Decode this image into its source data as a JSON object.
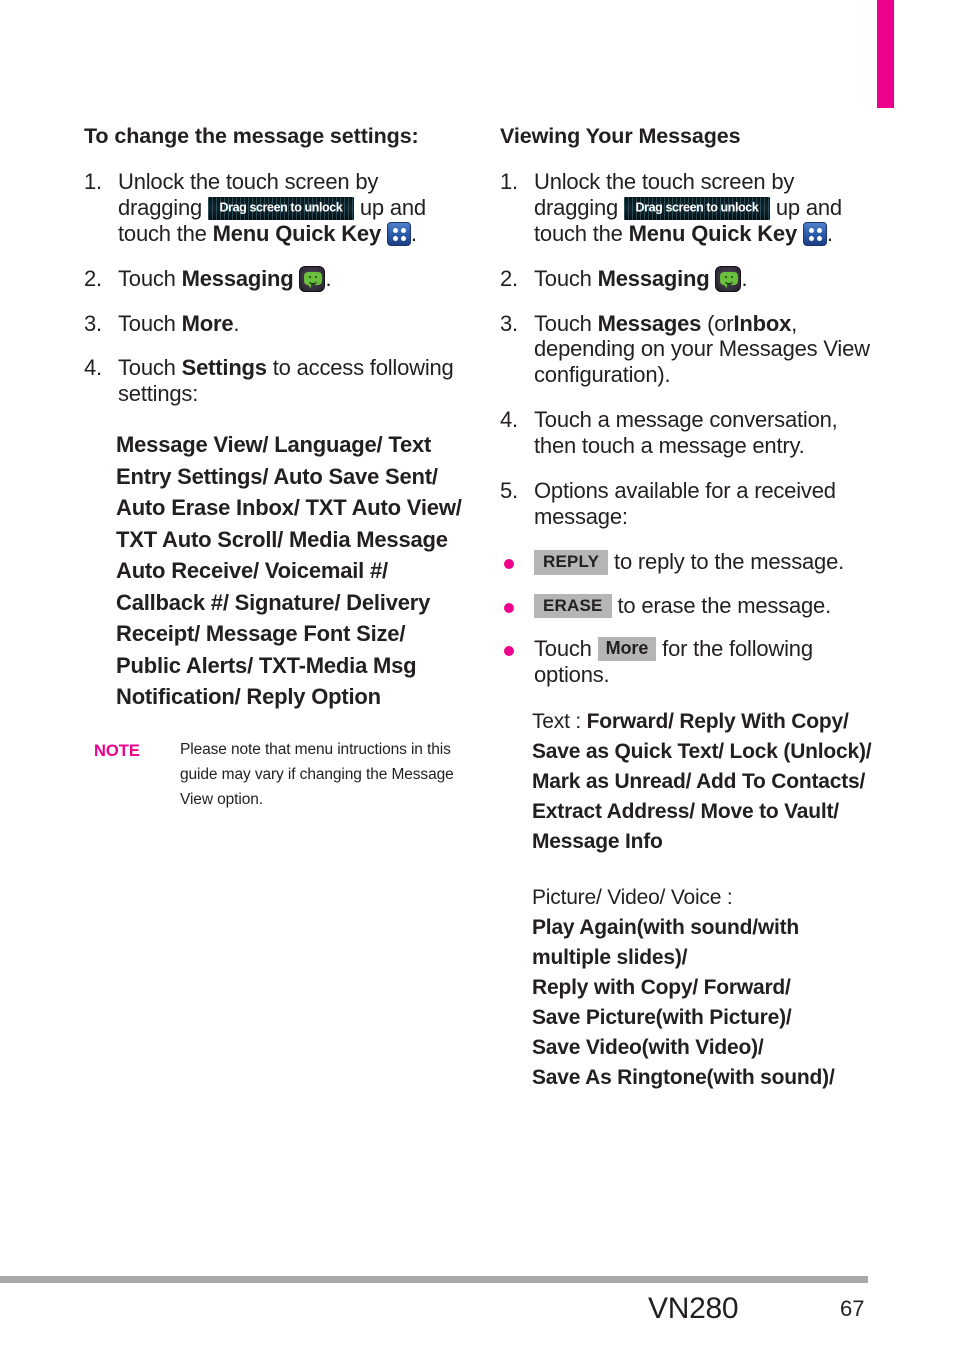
{
  "page": {
    "model": "VN280",
    "number": "67",
    "accent_pink": "#ec008c",
    "footer_rule_gray": "#a7a9ac",
    "chip_gray": "#b5b5b5"
  },
  "icons": {
    "unlock_bar_label": "Drag screen to unlock",
    "quick_key_name": "menu-quick-key-icon",
    "messaging_name": "messaging-app-icon"
  },
  "left": {
    "title": "To change the message settings:",
    "steps": [
      {
        "num": "1.",
        "pre": "Unlock the touch screen by dragging",
        "mid": "up and touch the",
        "bold": "Menu Quick Key",
        "post": "."
      },
      {
        "num": "2.",
        "pre": "Touch",
        "bold": "Messaging",
        "post": "."
      },
      {
        "num": "3.",
        "pre": "Touch",
        "bold": "More",
        "post": "."
      },
      {
        "num": "4.",
        "pre": "Touch",
        "bold": "Settings",
        "post": "to access following settings:"
      }
    ],
    "settings_list": "Message View/ Language/ Text Entry Settings/ Auto Save Sent/ Auto Erase Inbox/ TXT Auto View/ TXT Auto Scroll/ Media Message Auto Receive/ Voicemail #/ Callback #/ Signature/ Delivery Receipt/ Message Font Size/ Public Alerts/ TXT-Media Msg Notification/ Reply Option",
    "note": {
      "label": "NOTE",
      "text": "Please note that menu intructions in this guide may vary if changing the Message View option."
    }
  },
  "right": {
    "title": "Viewing Your Messages",
    "steps": [
      {
        "num": "1.",
        "pre": "Unlock the touch screen by dragging",
        "mid": "up and touch the",
        "bold": "Menu Quick Key",
        "post": "."
      },
      {
        "num": "2.",
        "pre": "Touch",
        "bold": "Messaging",
        "post": "."
      },
      {
        "num": "3.",
        "pre": "Touch",
        "bold": "Messages",
        "mid2": "(or",
        "bold2": "Inbox",
        "post": ", depending on your Messages View configuration)."
      },
      {
        "num": "4.",
        "pre": "Touch a message conversation, then touch a message entry."
      },
      {
        "num": "5.",
        "pre": "Options available for a received message:"
      }
    ],
    "bullets": [
      {
        "chip": "REPLY",
        "text": "to reply to the message."
      },
      {
        "chip": "ERASE",
        "text": "to erase the message."
      },
      {
        "pre": "Touch",
        "chip": "More",
        "text": "for the following options."
      }
    ],
    "options": {
      "text_label": "Text :",
      "text_list": "Forward/ Reply With Copy/ Save as Quick Text/ Lock (Unlock)/ Mark as Unread/ Add To Contacts/ Extract Address/ Move to Vault/ Message Info",
      "media_label": "Picture/ Video/ Voice :",
      "media_list": "Play Again(with sound/with multiple slides)/\nReply with Copy/ Forward/\nSave Picture(with Picture)/\nSave Video(with Video)/\nSave As Ringtone(with sound)/"
    }
  }
}
